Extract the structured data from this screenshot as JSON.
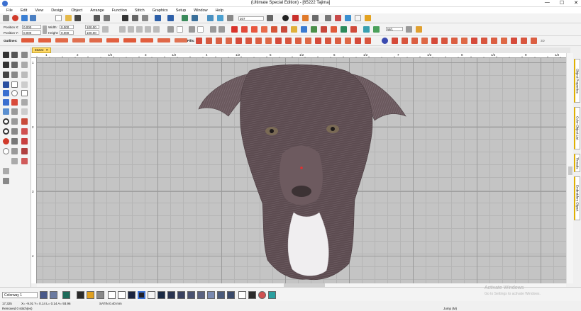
{
  "window": {
    "title": "(Ultimate Special Edition) - [65222    Tajima]",
    "controls": [
      "—",
      "☐",
      "✕"
    ]
  },
  "menu": [
    "File",
    "Edit",
    "View",
    "Design",
    "Object",
    "Arrange",
    "Function",
    "Stitch",
    "Graphics",
    "Setup",
    "Window",
    "Help"
  ],
  "toolbar1": {
    "zoom_value": "207",
    "zoom_icon": "magnifier-icon"
  },
  "toolbar2": {
    "position_x_label": "Position X:",
    "position_x_value": "0.000",
    "position_y_label": "Position Y:",
    "position_y_value": "0.000",
    "width_label": "Width:",
    "width_value": "0.000",
    "height_label": "Height:",
    "height_value": "0.000",
    "width_pct": "100.00",
    "height_pct": "100.00",
    "units_value": "W/L"
  },
  "toolbar3": {
    "outlines_label": "Outlines:",
    "fills_label": "Fills:",
    "threed_label": "3D"
  },
  "document_tab": {
    "name": "65222",
    "close": "✕"
  },
  "ruler": {
    "top_marks": [
      "1",
      "2",
      "1/2",
      "3",
      "1/2",
      "4",
      "1/2",
      "5",
      "1/2",
      "6",
      "1/2",
      "7",
      "1/2",
      "8",
      "1/2",
      "9",
      "1/2"
    ],
    "left_marks": [
      "1",
      "2",
      "3",
      "4"
    ]
  },
  "right_panels": [
    "Object Properties",
    "Color-Object List",
    "Threads",
    "Embroidery Clipart"
  ],
  "bottom": {
    "colorway": "Colorway 1"
  },
  "status": {
    "stitches": "17,325",
    "coords": "X= -9.01 Y= 0.14 L= 0.14 A= 93.96",
    "satin": "SATIN  0.40 mm",
    "removed": "Removed 0 stitch(es)",
    "jump": "Jump (M)"
  },
  "watermark": {
    "line1": "Activate Windows",
    "line2": "Go to Settings to activate Windows."
  },
  "colors": {
    "accent": "#ffd966",
    "canvas": "#c4c4c4",
    "dog_fur": "#5a4a4f",
    "dog_white": "#f2f2f2"
  }
}
